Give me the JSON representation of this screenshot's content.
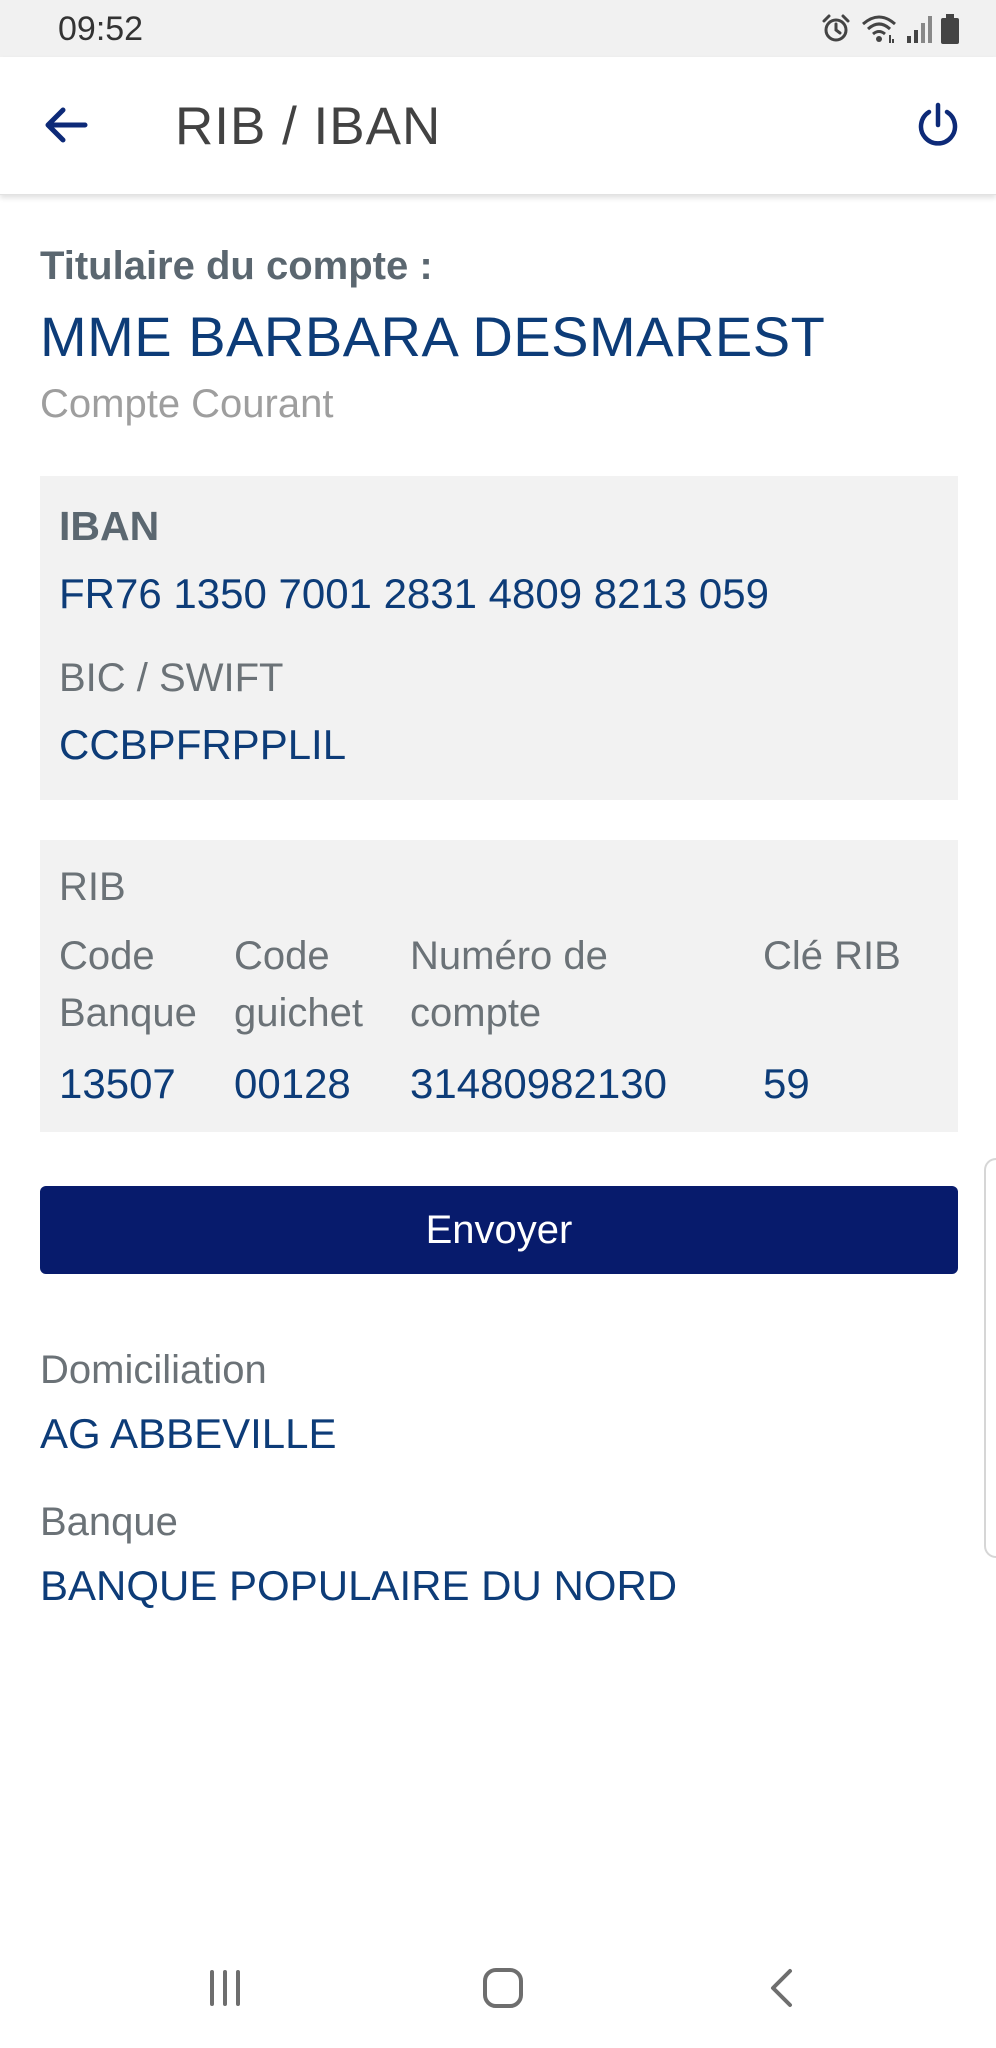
{
  "status_bar": {
    "time": "09:52",
    "icons": [
      "alarm-icon",
      "wifi-icon",
      "signal-icon",
      "battery-icon"
    ]
  },
  "app_bar": {
    "title": "RIB / IBAN",
    "back_icon": "arrow-left-icon",
    "power_icon": "power-icon"
  },
  "account": {
    "holder_label": "Titulaire du compte :",
    "holder_name": "MME BARBARA DESMAREST",
    "type": "Compte Courant"
  },
  "iban_card": {
    "iban_label": "IBAN",
    "iban_value": "FR76 1350 7001 2831 4809 8213 059",
    "bic_label": "BIC / SWIFT",
    "bic_value": "CCBPFRPPLIL"
  },
  "rib_card": {
    "label": "RIB",
    "columns": [
      {
        "header": "Code\nBanque",
        "value": "13507"
      },
      {
        "header": "Code\nguichet",
        "value": "00128"
      },
      {
        "header": "Numéro de\ncompte",
        "value": "31480982130"
      },
      {
        "header": "Clé RIB",
        "value": "59"
      }
    ]
  },
  "send_button": {
    "label": "Envoyer"
  },
  "domiciliation": {
    "label": "Domiciliation",
    "value": "AG ABBEVILLE"
  },
  "bank": {
    "label": "Banque",
    "value": "BANQUE POPULAIRE DU NORD"
  },
  "nav_bar": {
    "icons": [
      "recents-icon",
      "home-icon",
      "back-icon"
    ]
  },
  "colors": {
    "primary_text": "#0d3c78",
    "label_text": "#5b6770",
    "card_bg": "#f2f2f2",
    "button_bg": "#071b6c"
  }
}
